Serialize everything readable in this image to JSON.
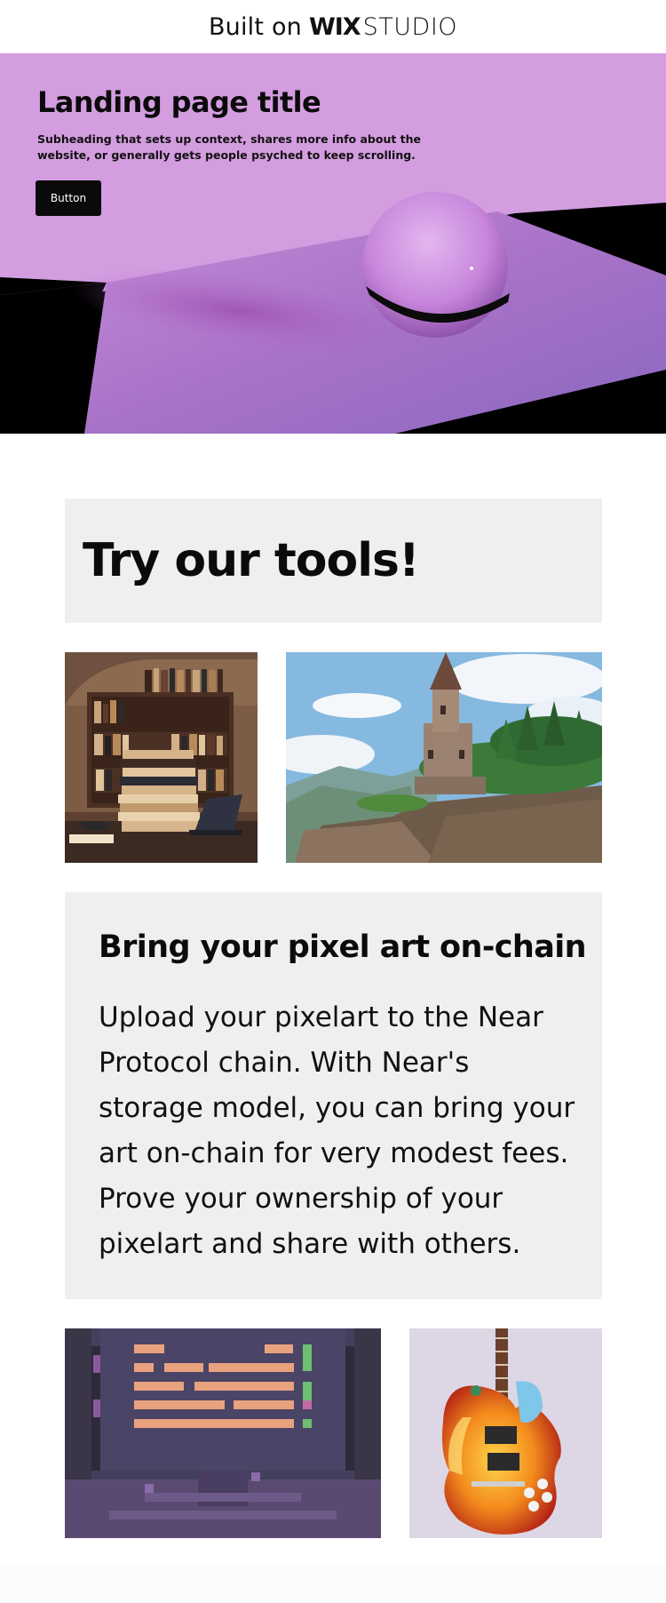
{
  "banner": {
    "prefix": "Built on",
    "logo_bold": "WIX",
    "logo_light": "STUDIO"
  },
  "hero": {
    "title": "Landing page title",
    "subtitle": "Subheading that sets up context, shares more info about the website, or generally gets people psyched to keep scrolling.",
    "button_label": "Button"
  },
  "tools": {
    "title": "Try our tools!"
  },
  "gallery_top": [
    {
      "name": "library-books-pixel-art",
      "alt": ""
    },
    {
      "name": "castle-cliff-pixel-art",
      "alt": ""
    }
  ],
  "info": {
    "title": "Bring your pixel art on-chain",
    "body": "Upload your pixelart to the Near Protocol chain. With Near's storage model, you can bring your art on-chain for very modest fees. Prove your ownership of your pixelart and share with others."
  },
  "gallery_bottom": [
    {
      "name": "retro-terminal-pixel-art",
      "alt": ""
    },
    {
      "name": "electric-guitar-pixel-art",
      "alt": ""
    }
  ],
  "colors": {
    "hero_bg": "#d49de0",
    "panel_bg": "#efefef",
    "button_bg": "#0a0a0a",
    "text": "#0b0b0b"
  }
}
